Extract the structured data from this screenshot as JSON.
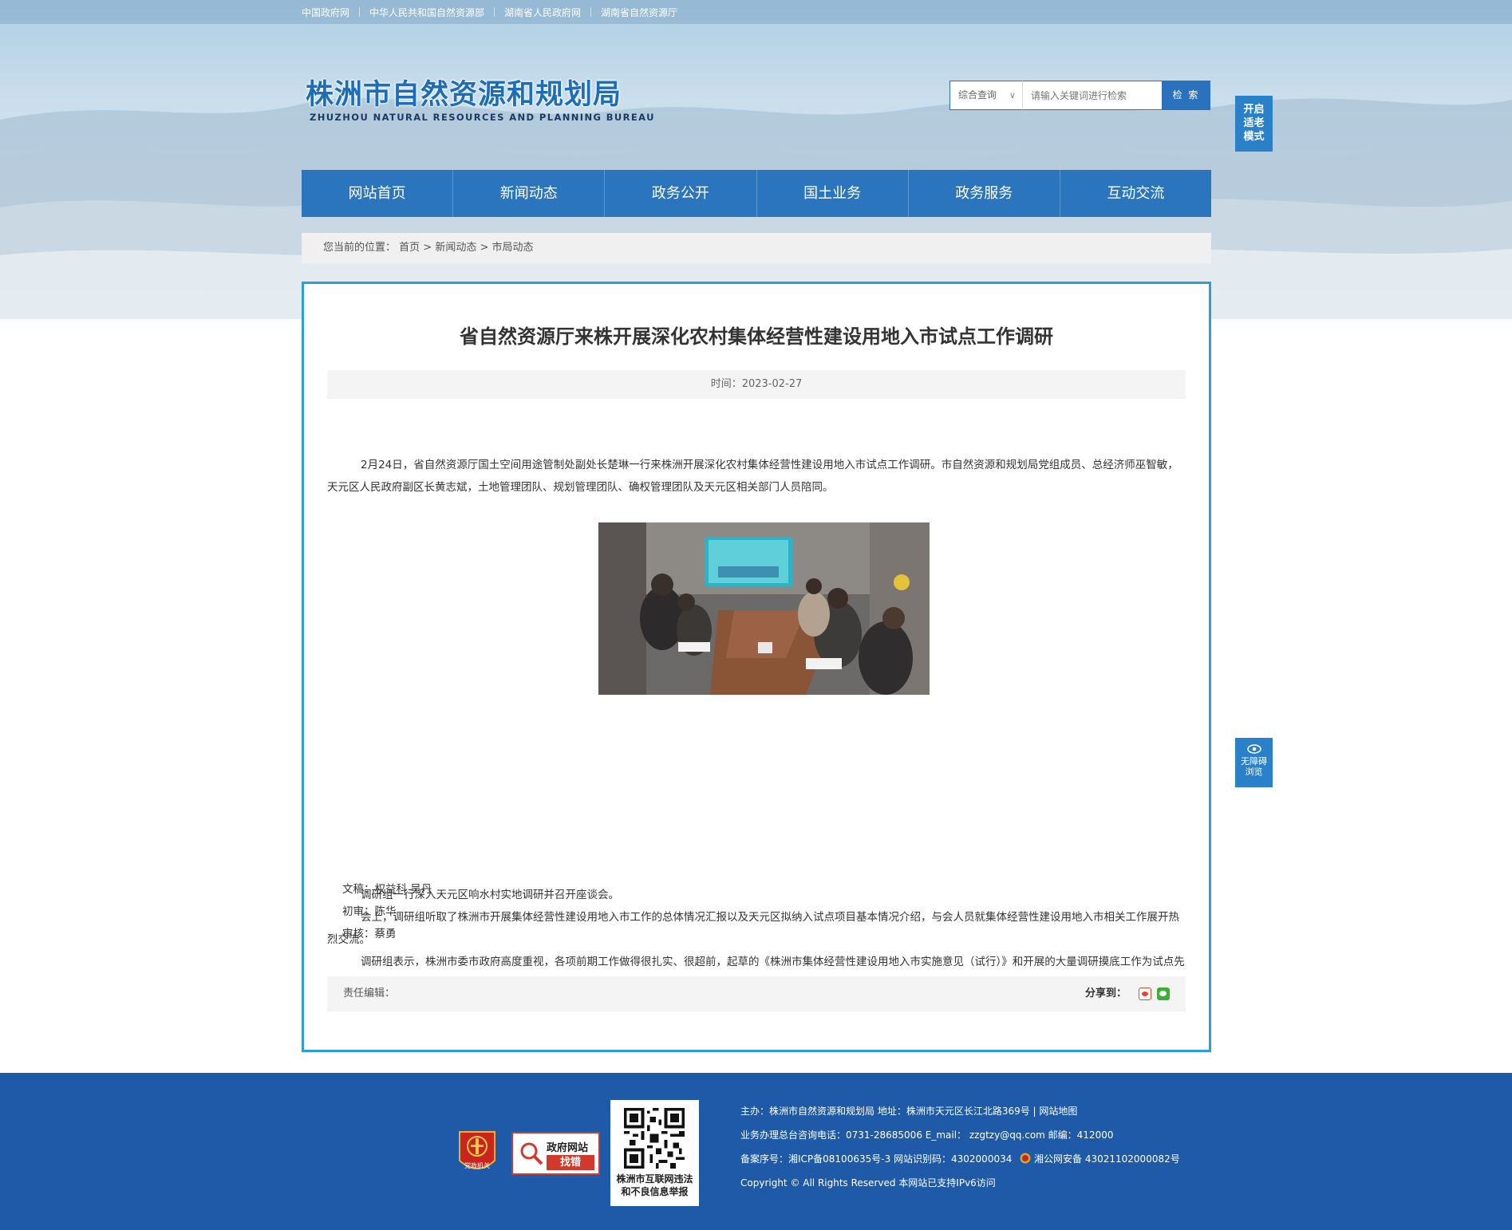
{
  "top_links": [
    "中国政府网",
    "中华人民共和国自然资源部",
    "湖南省人民政府网",
    "湖南省自然资源厅"
  ],
  "logo": {
    "cn": "株洲市自然资源和规划局",
    "en": "ZHUZHOU NATURAL RESOURCES AND PLANNING BUREAU"
  },
  "search": {
    "select_value": "综合查询",
    "placeholder": "请输入关键词进行检索",
    "button": "检 索"
  },
  "elder_mode": [
    "开启",
    "适老",
    "模式"
  ],
  "accessible": [
    "无障碍",
    "浏览"
  ],
  "nav": [
    "网站首页",
    "新闻动态",
    "政务公开",
    "国土业务",
    "政务服务",
    "互动交流"
  ],
  "breadcrumb": {
    "prefix": "您当前的位置：",
    "items": [
      "首页",
      "新闻动态",
      "市局动态"
    ],
    "sep": " > "
  },
  "article": {
    "title": "省自然资源厅来株开展深化农村集体经营性建设用地入市试点工作调研",
    "time": "时间：2023-02-27",
    "paragraphs": [
      "2月24日，省自然资源厅国土空间用途管制处副处长楚琳一行来株洲开展深化农村集体经营性建设用地入市试点工作调研。市自然资源和规划局党组成员、总经济师巫智敏，天元区人民政府副区长黄志斌，土地管理团队、规划管理团队、确权管理团队及天元区相关部门人员陪同。",
      "调研组一行深入天元区响水村实地调研并召开座谈会。",
      "会上，调研组听取了株洲市开展集体经营性建设用地入市工作的总体情况汇报以及天元区拟纳入试点项目基本情况介绍，与会人员就集体经营性建设用地入市相关工作展开热烈交流。",
      "调研组表示，株洲市委市政府高度重视，各项前期工作做得很扎实、很超前，起草的《株洲市集体经营性建设用地入市实施意见（试行）》和开展的大量调研摸底工作为试点先行打下了良好基础；天元区政府入市需求高，基础条件好，已将天元区上报自然资源部国家级试点。同时强调在试点实践中要提高认识，守住红线底线，确保农民利益不受损，坚持集约节约用地，坚持同地、同权、同责，注重质效，确保按照部、省的统一部署，完成试点工作任务。"
    ],
    "credits": [
      "文稿：权益科 吴丹",
      "初审：陈华",
      "审核：蔡勇"
    ],
    "editor": "责任编辑：",
    "share_label": "分享到："
  },
  "footer": {
    "badge_party": "党政机关",
    "badge_gov_line1": "政府网站",
    "badge_gov_line2": "找错",
    "qr_caption": [
      "株洲市互联网违法",
      "和不良信息举报"
    ],
    "line1": "主办：株洲市自然资源和规划局   地址：株洲市天元区长江北路369号  |  网站地图",
    "line2": "业务办理总台咨询电话：0731-28685006     E_mail：  zzgtzy@qq.com     邮编：412000",
    "line3_a": "备案序号：湘ICP备08100635号-3  网站识别码：4302000034",
    "line3_b": "湘公网安备 43021102000082号",
    "line4": "Copyright © All Rights Reserved 本网站已支持IPv6访问"
  },
  "colors": {
    "accent": "#2a75be",
    "box_border": "#2a9fd8",
    "footer_bg": "#1e5aa8"
  }
}
